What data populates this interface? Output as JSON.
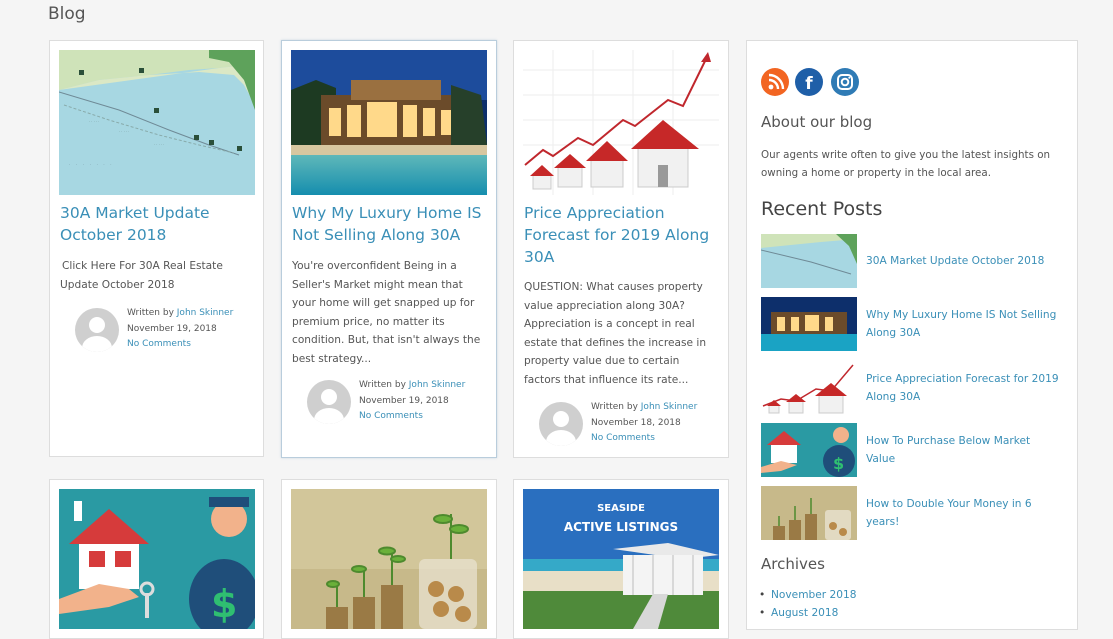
{
  "page": {
    "title": "Blog"
  },
  "posts": [
    {
      "title_lines": [
        "30A Market Update",
        "October 2018"
      ],
      "excerpt_lines": [
        "Click Here For 30A Real Estate",
        "Update  October 2018"
      ],
      "written_by": "Written by",
      "author": "John Skinner",
      "date": "November 19, 2018",
      "comments": "No Comments"
    },
    {
      "title_lines": [
        "Why My Luxury Home IS",
        "Not Selling Along 30A"
      ],
      "excerpt_lines": [
        "You're overconfident Being in a",
        "Seller's Market might mean that",
        "your home will get snapped up for",
        "premium price, no matter its",
        "condition. But, that isn't always the",
        "best strategy..."
      ],
      "written_by": "Written by",
      "author": "John Skinner",
      "date": "November 19, 2018",
      "comments": "No Comments"
    },
    {
      "title_lines": [
        "Price Appreciation",
        "Forecast for 2019 Along",
        "30A"
      ],
      "excerpt_lines": [
        "QUESTION: What causes property",
        "value appreciation along 30A?",
        "Appreciation is a concept in real",
        "estate that defines the increase in",
        "property value due to certain",
        "factors that influence its rate..."
      ],
      "written_by": "Written by",
      "author": "John Skinner",
      "date": "November 18, 2018",
      "comments": "No Comments"
    }
  ],
  "bottom_cards": [
    {
      "image_text_line1": "SEASIDE",
      "image_text_line2": "ACTIVE LISTINGS"
    }
  ],
  "sidebar": {
    "social": [
      "rss-icon",
      "facebook-icon",
      "instagram-icon"
    ],
    "about_heading": "About our blog",
    "about_lines": [
      "Our agents write often to give you the latest insights on",
      "owning a home or property in the local area."
    ],
    "recent_heading": "Recent Posts",
    "recent": [
      {
        "lines": [
          "30A Market Update October 2018"
        ]
      },
      {
        "lines": [
          "Why My Luxury Home IS Not Selling",
          "Along 30A"
        ]
      },
      {
        "lines": [
          "Price Appreciation Forecast for 2019",
          "Along 30A"
        ]
      },
      {
        "lines": [
          "How To Purchase Below Market",
          "Value"
        ]
      },
      {
        "lines": [
          "How to Double Your Money in 6",
          "years!"
        ]
      }
    ],
    "archives_heading": "Archives",
    "archives": [
      "November 2018",
      "August 2018"
    ]
  },
  "colors": {
    "link": "#3a8fb7",
    "rss": "#f26522",
    "facebook": "#1f5fa8",
    "instagram": "#2f7bb5"
  }
}
